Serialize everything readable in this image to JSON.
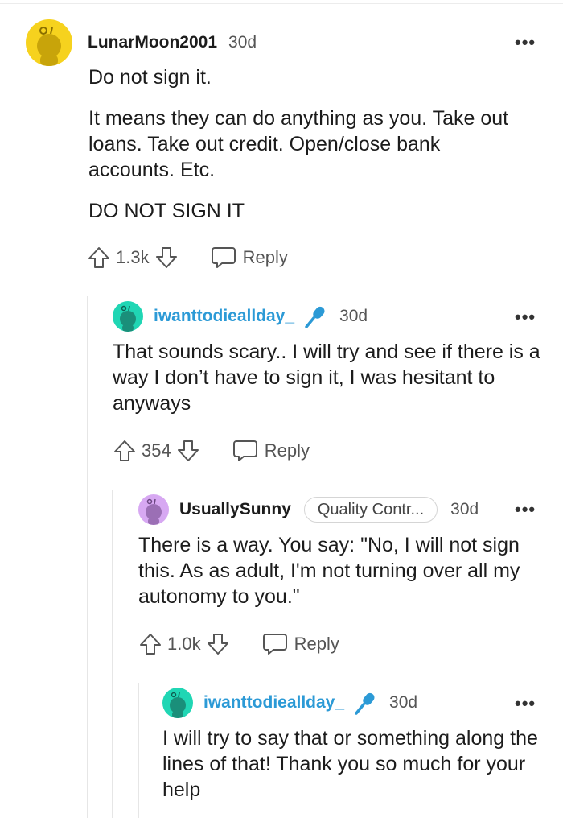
{
  "comments": [
    {
      "username": "LunarMoon2001",
      "age": "30d",
      "paragraphs": [
        "Do not sign it.",
        "It means they can do anything as you. Take out loans. Take out credit. Open/close bank accounts. Etc.",
        "DO NOT SIGN IT"
      ],
      "votes": "1.3k",
      "reply_label": "Reply",
      "avatar_color": "#f6d21e"
    },
    {
      "username": "iwanttodieallday_",
      "age": "30d",
      "paragraphs": [
        "That sounds scary.. I will try and see if there is a way I don’t have to sign it, I was hesitant to anyways"
      ],
      "votes": "354",
      "reply_label": "Reply",
      "avatar_color": "#20d6b4"
    },
    {
      "username": "UsuallySunny",
      "flair": "Quality Contr...",
      "age": "30d",
      "paragraphs": [
        "There is a way. You say: \"No, I will not sign this. As as adult, I'm not turning over all my autonomy to you.\""
      ],
      "votes": "1.0k",
      "reply_label": "Reply",
      "avatar_color": "#d7a8f2"
    },
    {
      "username": "iwanttodieallday_",
      "age": "30d",
      "paragraphs": [
        "I will try to say that or something along the lines of that! Thank you so much for your help"
      ],
      "avatar_color": "#20d6b4"
    }
  ],
  "icons": {
    "more": "more-icon",
    "upvote": "upvote-arrow-icon",
    "downvote": "downvote-arrow-icon",
    "reply": "speech-bubble-icon",
    "op_badge": "microphone-icon"
  },
  "colors": {
    "op_username": "#2c9ad6",
    "mic": "#2c9ad6"
  }
}
